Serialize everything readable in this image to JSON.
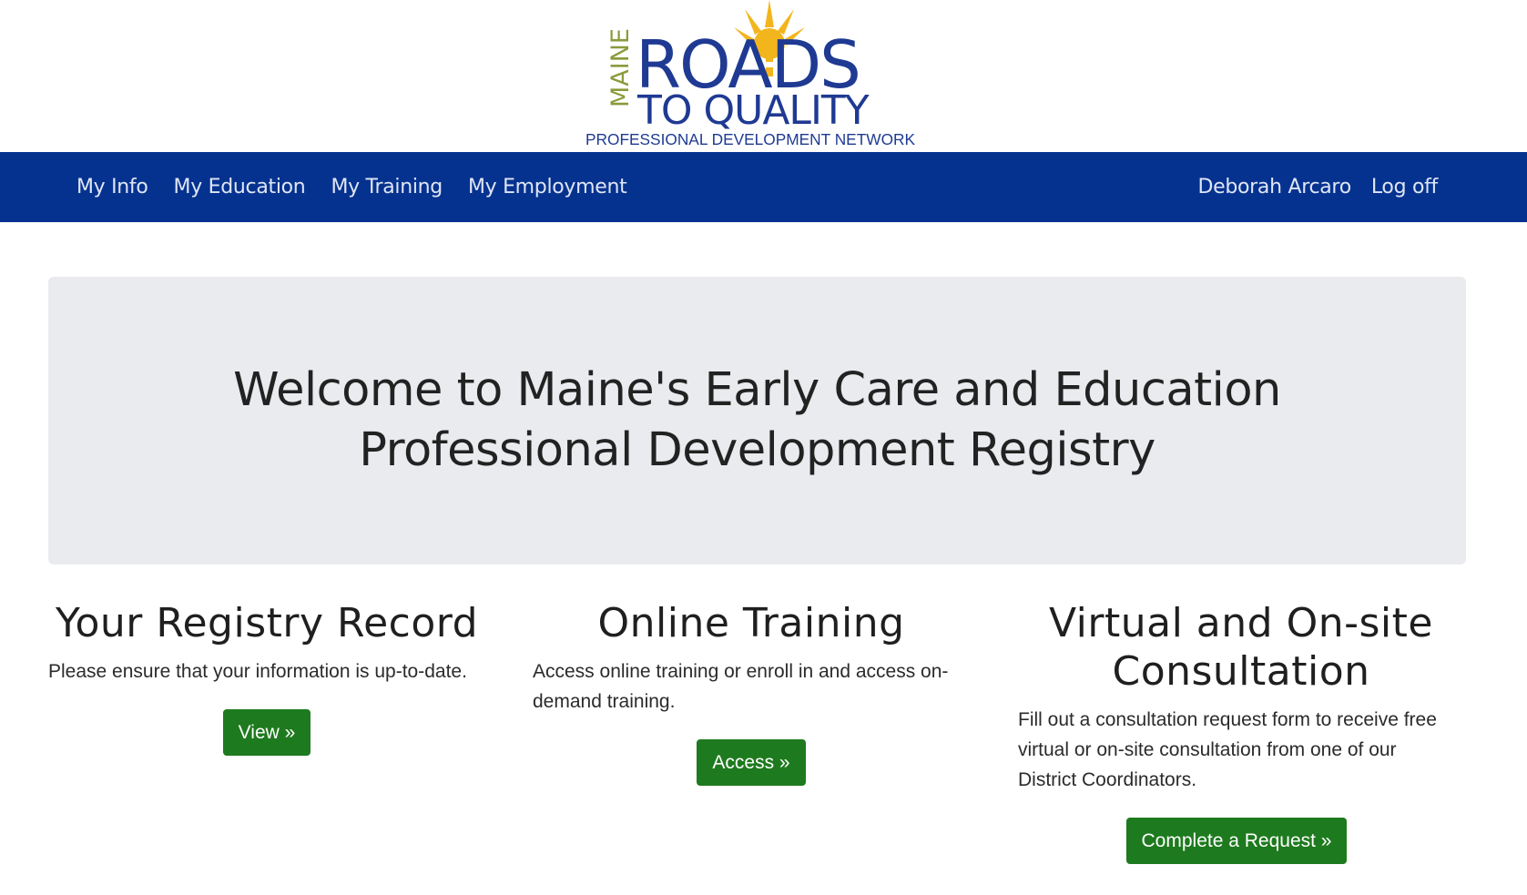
{
  "logo": {
    "maine": "MAINE",
    "roads": "ROADS",
    "to_quality": "TO QUALITY",
    "tagline": "PROFESSIONAL DEVELOPMENT NETWORK",
    "colors": {
      "blue": "#1f3a93",
      "olive": "#8c9a3b",
      "sun": "#f2b51c"
    }
  },
  "nav": {
    "left": [
      {
        "label": "My Info"
      },
      {
        "label": "My Education"
      },
      {
        "label": "My Training"
      },
      {
        "label": "My Employment"
      }
    ],
    "user": "Deborah Arcaro",
    "logoff": "Log off",
    "bg_color": "#06328f"
  },
  "jumbotron": {
    "title": "Welcome to Maine's Early Care and Education Professional Development Registry"
  },
  "sections": [
    {
      "heading": "Your Registry Record",
      "text": "Please ensure that your information is up-to-date.",
      "button": "View »"
    },
    {
      "heading": "Online Training",
      "text": "Access online training or enroll in and access on-demand training.",
      "button": "Access »"
    },
    {
      "heading": "Virtual and On-site Consultation",
      "text": "Fill out a consultation request form to receive free virtual or on-site consultation from one of our District Coordinators.",
      "button": "Complete a Request »"
    }
  ],
  "button_color": "#1e7a1e"
}
